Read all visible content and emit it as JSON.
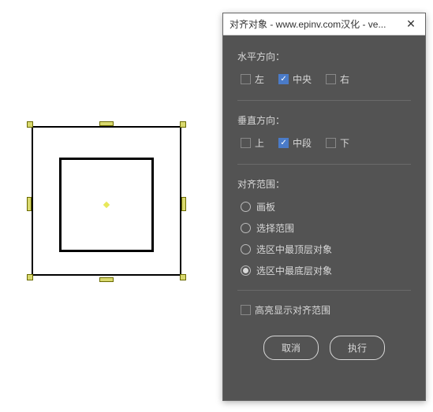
{
  "dialog": {
    "title": "对齐对象 - www.epinv.com汉化 - ve...",
    "horizontal": {
      "label": "水平方向：",
      "left": "左",
      "center": "中央",
      "right": "右",
      "checked": "center"
    },
    "vertical": {
      "label": "垂直方向：",
      "top": "上",
      "middle": "中段",
      "bottom": "下",
      "checked": "middle"
    },
    "scope": {
      "label": "对齐范围：",
      "options": {
        "artboard": "画板",
        "selection": "选择范围",
        "topmost": "选区中最顶层对象",
        "bottommost": "选区中最底层对象"
      },
      "selected": "bottommost"
    },
    "highlight": {
      "label": "高亮显示对齐范围",
      "checked": false
    },
    "buttons": {
      "cancel": "取消",
      "execute": "执行"
    }
  }
}
